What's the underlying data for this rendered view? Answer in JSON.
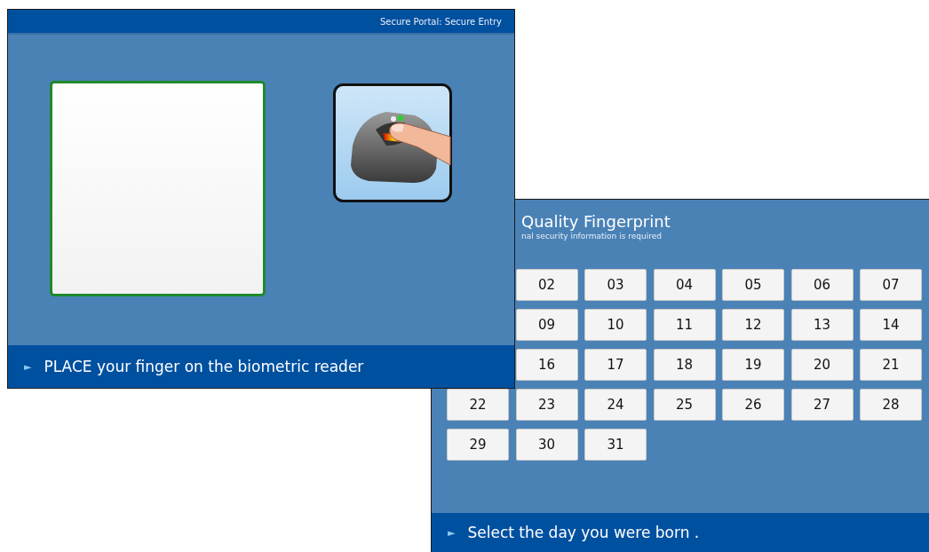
{
  "back_window": {
    "title": "Quality Fingerprint",
    "subtitle": "nal security information is required",
    "day_rows": [
      [
        "02",
        "03",
        "04",
        "05",
        "06",
        "07"
      ],
      [
        "09",
        "10",
        "11",
        "12",
        "13",
        "14"
      ],
      [
        "16",
        "17",
        "18",
        "19",
        "20",
        "21"
      ],
      [
        "22",
        "23",
        "24",
        "25",
        "26",
        "27",
        "28"
      ],
      [
        "29",
        "30",
        "31"
      ]
    ],
    "prompt_marker": "►",
    "prompt": "Select the day you were born ."
  },
  "front_window": {
    "title": "Secure Portal: Secure Entry",
    "prompt_marker": "►",
    "prompt": "PLACE your finger on the biometric reader"
  }
}
